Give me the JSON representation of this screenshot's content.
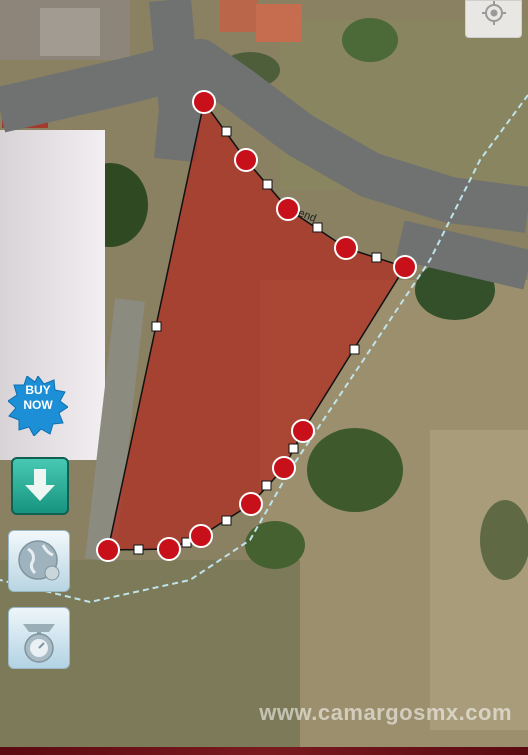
{
  "map": {
    "street_label": "end",
    "watermark": "www.camargosmx.com",
    "colors": {
      "polygon_fill": "#b02a1e",
      "vertex": "#c8101b",
      "road": "#6f7271",
      "boundary_line": "#bfe3ea"
    }
  },
  "buttons": {
    "buy_now": "BUY\nNOW",
    "locate_icon": "crosshair-icon",
    "download_icon": "download-arrow-icon",
    "map_icon": "globe-map-icon",
    "area_icon": "scale-icon"
  }
}
